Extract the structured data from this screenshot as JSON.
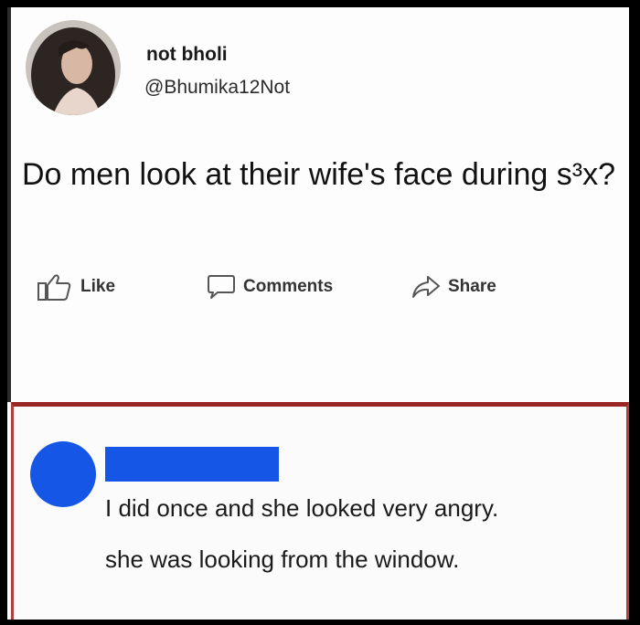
{
  "post": {
    "author_name": "not bholi",
    "author_handle": "@Bhumika12Not",
    "text": "Do men look at their wife's face during s³x?"
  },
  "actions": {
    "like_label": "Like",
    "comments_label": "Comments",
    "share_label": "Share"
  },
  "comment": {
    "line_1": "I did once and she looked very angry.",
    "line_2": "she was looking from the window."
  },
  "colors": {
    "redaction_blue": "#1656e6",
    "comment_border": "#9a2525",
    "frame_background": "#000000"
  }
}
